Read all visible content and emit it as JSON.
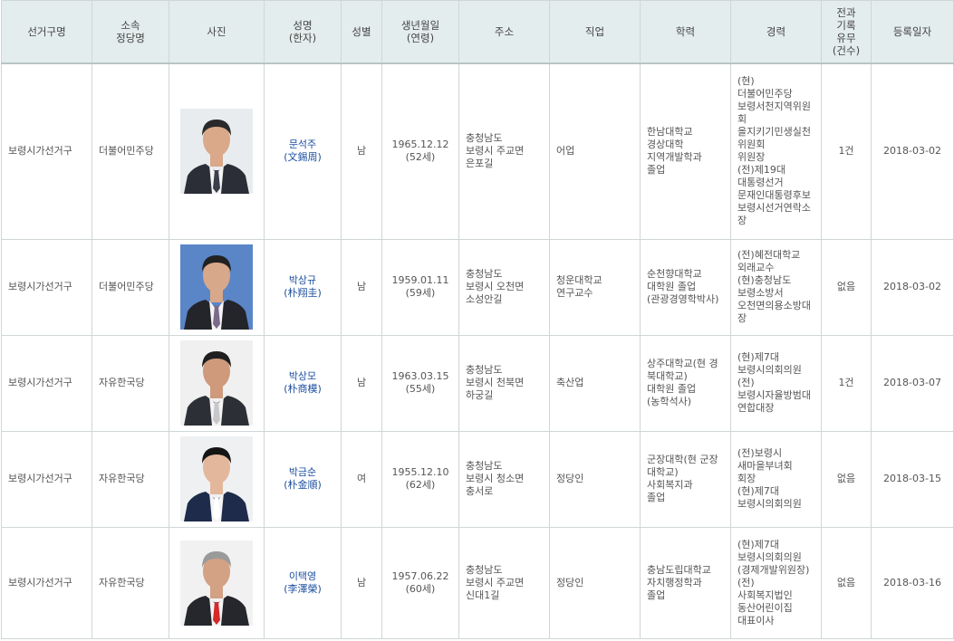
{
  "headers": {
    "district": "선거구명",
    "party": "소속\n정당명",
    "photo": "사진",
    "name": "성명\n(한자)",
    "gender": "성별",
    "birth": "생년월일\n(연령)",
    "address": "주소",
    "job": "직업",
    "education": "학력",
    "career": "경력",
    "record": "전과\n기록\n유무\n(건수)",
    "regdate": "등록일자"
  },
  "candidates": [
    {
      "district": "보령시가선거구",
      "party": "더불어민주당",
      "name": "문석주",
      "hanja": "(文錫周)",
      "gender": "남",
      "birth": "1965.12.12",
      "age": "(52세)",
      "address": "충청남도\n보령시 주교면\n은포길",
      "job": "어업",
      "education": "한남대학교\n경상대학\n지역개발학과\n졸업",
      "career": "(현)\n더불어민주당\n보령서천지역위원회\n을지키기민생실천위원회\n위원장\n(전)제19대\n대통령선거\n문재인대통령후보\n보령시선거연락소장",
      "record": "1건",
      "regdate": "2018-03-02",
      "photo_bg": "#e9ecee",
      "suit_color": "#2b2e36",
      "tie_color": "#3a3f4a",
      "hair_color": "#2a2a2a",
      "skin_color": "#d9a98a"
    },
    {
      "district": "보령시가선거구",
      "party": "더불어민주당",
      "name": "박상규",
      "hanja": "(朴翔圭)",
      "gender": "남",
      "birth": "1959.01.11",
      "age": "(59세)",
      "address": "충청남도\n보령시 오천면\n소성안길",
      "job": "청운대학교\n연구교수",
      "education": "순천향대학교\n대학원 졸업\n(관광경영학박사)",
      "career": "(전)혜전대학교\n외래교수\n(현)충청남도\n보령소방서\n오천면의용소방대장",
      "record": "없음",
      "regdate": "2018-03-02",
      "photo_bg": "#5a86c8",
      "suit_color": "#23252b",
      "tie_color": "#7b6a8a",
      "hair_color": "#222222",
      "skin_color": "#d8a88a"
    },
    {
      "district": "보령시가선거구",
      "party": "자유한국당",
      "name": "박상모",
      "hanja": "(朴商模)",
      "gender": "남",
      "birth": "1963.03.15",
      "age": "(55세)",
      "address": "충청남도\n보령시 천북면\n하궁길",
      "job": "축산업",
      "education": "상주대학교(현 경북대학교)\n대학원 졸업\n(농학석사)",
      "career": "(현)제7대\n보령시의회의원\n(전)\n보령시자율방범대 연합대장",
      "record": "1건",
      "regdate": "2018-03-07",
      "photo_bg": "#f0f0f0",
      "suit_color": "#2c2f35",
      "tie_color": "#c8c8cc",
      "hair_color": "#1f1f1f",
      "skin_color": "#cf9a7c"
    },
    {
      "district": "보령시가선거구",
      "party": "자유한국당",
      "name": "박금순",
      "hanja": "(朴金順)",
      "gender": "여",
      "birth": "1955.12.10",
      "age": "(62세)",
      "address": "충청남도\n보령시 청소면\n충서로",
      "job": "정당인",
      "education": "군장대학(현 군장대학교)\n사회복지과\n졸업",
      "career": "(전)보령시\n새마을부녀회\n회장\n(현)제7대\n보령시의회의원",
      "record": "없음",
      "regdate": "2018-03-15",
      "photo_bg": "#eef0f2",
      "suit_color": "#1f2b4a",
      "tie_color": "#ffffff",
      "hair_color": "#141414",
      "skin_color": "#e3b79c"
    },
    {
      "district": "보령시가선거구",
      "party": "자유한국당",
      "name": "이택영",
      "hanja": "(李澤榮)",
      "gender": "남",
      "birth": "1957.06.22",
      "age": "(60세)",
      "address": "충청남도\n보령시 주교면\n신대1길",
      "job": "정당인",
      "education": "충남도립대학교\n자치행정학과\n졸업",
      "career": "(현)제7대\n보령시의회의원\n(경제개발위원장)\n(전)\n사회복지법인\n동산어린이집\n대표이사",
      "record": "없음",
      "regdate": "2018-03-16",
      "photo_bg": "#f1f1f1",
      "suit_color": "#25272d",
      "tie_color": "#d42a2a",
      "hair_color": "#9a9a9a",
      "skin_color": "#d3a184"
    }
  ]
}
